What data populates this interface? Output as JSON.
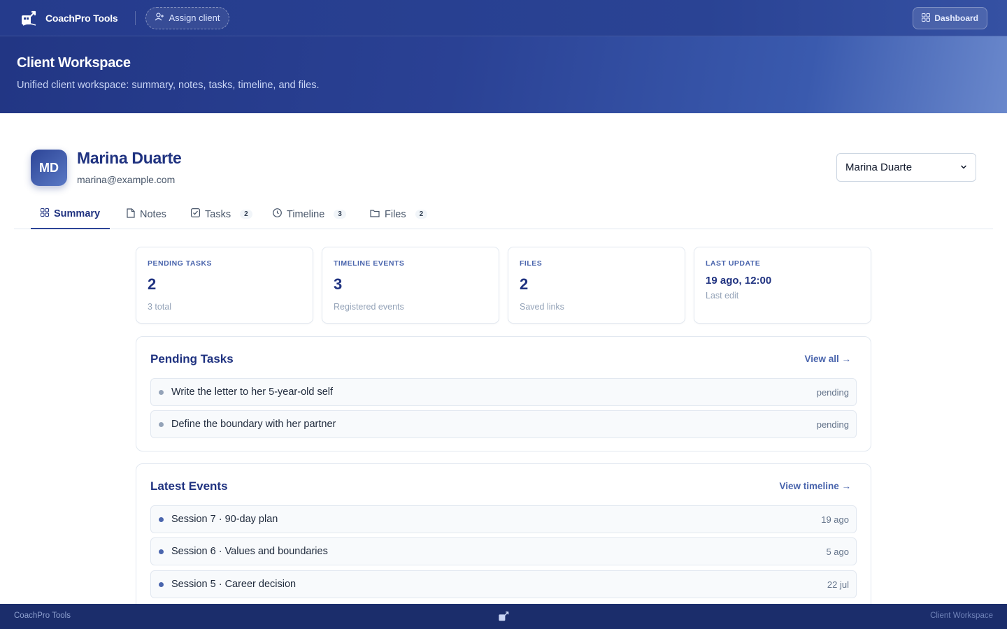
{
  "app": {
    "brand_name": "CoachPro Tools",
    "assign_label": "Assign client",
    "dashboard_label": "Dashboard"
  },
  "hero": {
    "title": "Client Workspace",
    "subtitle": "Unified client workspace: summary, notes, tasks, timeline, and files."
  },
  "client": {
    "initials": "MD",
    "name": "Marina Duarte",
    "email": "marina@example.com",
    "selected": "Marina Duarte"
  },
  "tabs": [
    {
      "label": "Summary",
      "count": null,
      "active": true
    },
    {
      "label": "Notes",
      "count": null
    },
    {
      "label": "Tasks",
      "count": "2"
    },
    {
      "label": "Timeline",
      "count": "3"
    },
    {
      "label": "Files",
      "count": "2"
    }
  ],
  "stats": [
    {
      "label": "PENDING TASKS",
      "value": "2",
      "sub": "3 total"
    },
    {
      "label": "TIMELINE EVENTS",
      "value": "3",
      "sub": "Registered events"
    },
    {
      "label": "FILES",
      "value": "2",
      "sub": "Saved links"
    },
    {
      "label": "LAST UPDATE",
      "value": "19 ago, 12:00",
      "sub": "Last edit"
    }
  ],
  "pending": {
    "title": "Pending Tasks",
    "link": "View all →",
    "items": [
      {
        "text": "Write the letter to her 5-year-old self",
        "status": "pending"
      },
      {
        "text": "Define the boundary with her partner",
        "status": "pending"
      }
    ]
  },
  "events": {
    "title": "Latest Events",
    "link": "View timeline →",
    "items": [
      {
        "text": "Session 7 · 90-day plan",
        "date": "19 ago"
      },
      {
        "text": "Session 6 · Values and boundaries",
        "date": "5 ago"
      },
      {
        "text": "Session 5 · Career decision",
        "date": "22 jul"
      }
    ]
  },
  "footer": {
    "left": "CoachPro Tools",
    "right": "Client Workspace"
  },
  "colors": {
    "primary": "#253b8c",
    "accent": "#4a65ad",
    "footer": "#1b2d6b"
  }
}
